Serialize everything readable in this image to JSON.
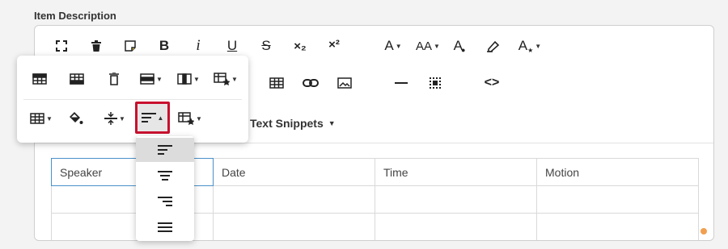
{
  "field": {
    "label": "Item Description"
  },
  "toolbar": {
    "row1": [
      {
        "name": "fullscreen-icon"
      },
      {
        "name": "trash-icon"
      },
      {
        "name": "sticky-note-icon"
      },
      {
        "name": "bold-icon",
        "text": "B"
      },
      {
        "name": "italic-icon",
        "text": "i"
      },
      {
        "name": "underline-icon",
        "text": "U"
      },
      {
        "name": "strikethrough-icon",
        "text": "S"
      },
      {
        "name": "subscript-icon",
        "text": "×₂"
      },
      {
        "name": "superscript-icon",
        "text": "×²"
      },
      {
        "name": "font-size-icon",
        "text": "A"
      },
      {
        "name": "font-case-icon",
        "text": "AA"
      },
      {
        "name": "font-color-icon",
        "text": "A"
      },
      {
        "name": "highlight-icon"
      },
      {
        "name": "font-style-icon",
        "text": "A"
      }
    ],
    "row2": [
      {
        "name": "insert-table-icon"
      },
      {
        "name": "insert-link-icon"
      },
      {
        "name": "insert-image-icon"
      },
      {
        "name": "horizontal-rule-icon"
      },
      {
        "name": "special-char-icon"
      },
      {
        "name": "code-view-icon",
        "text": "<>"
      }
    ],
    "snippets_label": "Text Snippets"
  },
  "table": {
    "headers": [
      "Speaker",
      "Date",
      "Time",
      "Motion"
    ],
    "rows": [
      [
        "",
        "",
        "",
        ""
      ],
      [
        "",
        "",
        "",
        ""
      ]
    ]
  },
  "table_popup": {
    "row1": [
      "table-header-icon",
      "table-footer-icon",
      "table-remove-icon",
      "table-row-icon",
      "table-column-icon",
      "table-style-icon"
    ],
    "row2": [
      "cell-icon",
      "cell-background-icon",
      "vertical-align-icon",
      "horizontal-align-icon",
      "cell-style-icon"
    ],
    "selected": "horizontal-align-icon"
  },
  "align_dropdown": {
    "options": [
      "align-left-icon",
      "align-center-icon",
      "align-right-icon",
      "align-justify-icon"
    ],
    "active": "align-left-icon"
  },
  "colors": {
    "accent": "#c8102e",
    "active_cell": "#4a90c8",
    "resize_dot": "#f0a050"
  }
}
